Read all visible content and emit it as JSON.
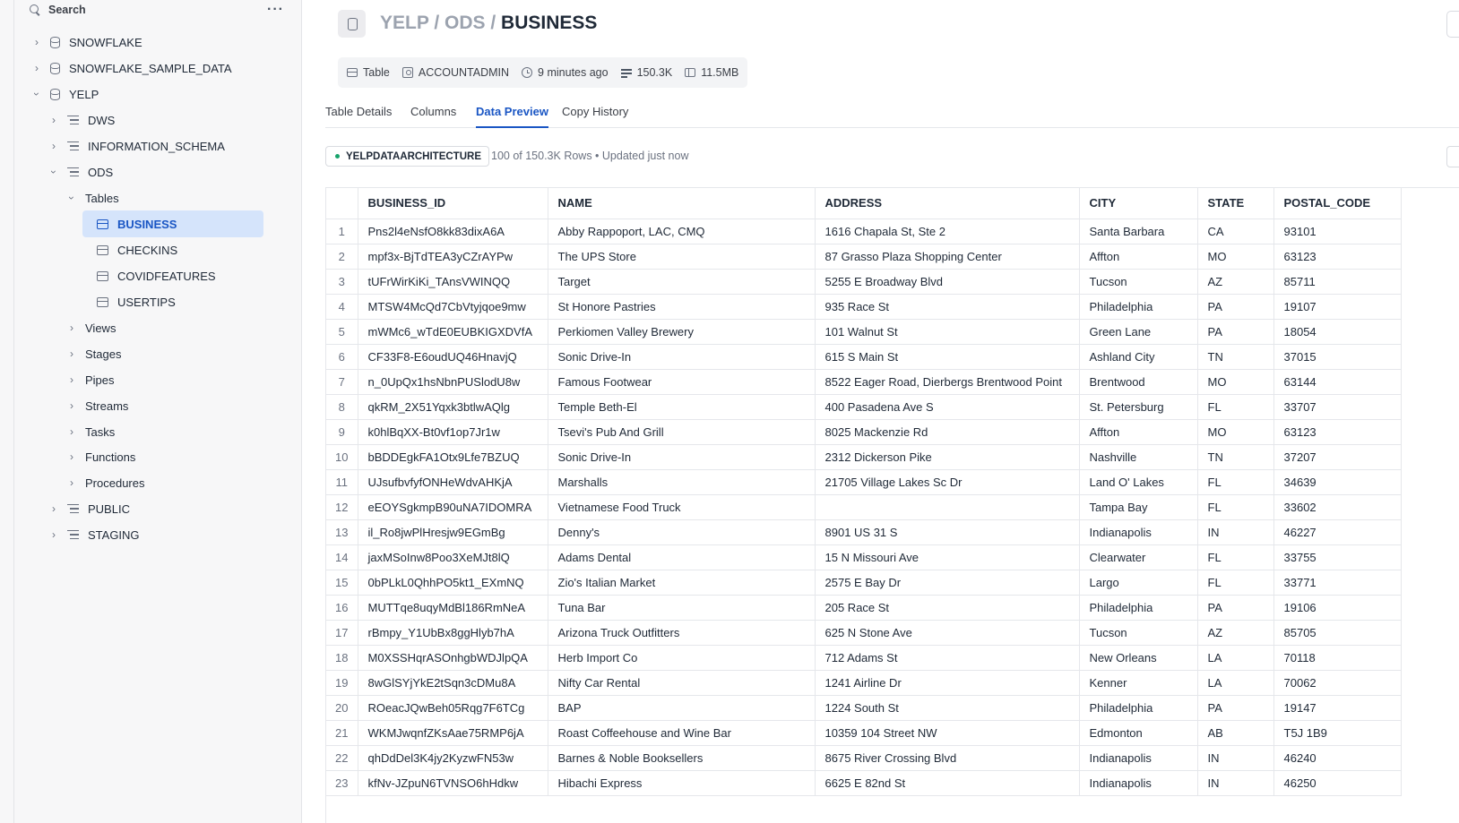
{
  "sidebar": {
    "search_label": "Search",
    "more_label": "···",
    "databases": [
      {
        "label": "SNOWFLAKE"
      },
      {
        "label": "SNOWFLAKE_SAMPLE_DATA"
      },
      {
        "label": "YELP"
      }
    ],
    "schemas": [
      {
        "label": "DWS"
      },
      {
        "label": "INFORMATION_SCHEMA"
      },
      {
        "label": "ODS"
      },
      {
        "label": "PUBLIC"
      },
      {
        "label": "STAGING"
      }
    ],
    "tables_group": "Tables",
    "tables": [
      {
        "label": "BUSINESS"
      },
      {
        "label": "CHECKINS"
      },
      {
        "label": "COVIDFEATURES"
      },
      {
        "label": "USERTIPS"
      }
    ],
    "object_groups": [
      {
        "label": "Views"
      },
      {
        "label": "Stages"
      },
      {
        "label": "Pipes"
      },
      {
        "label": "Streams"
      },
      {
        "label": "Tasks"
      },
      {
        "label": "Functions"
      },
      {
        "label": "Procedures"
      }
    ]
  },
  "header": {
    "crumb_db": "YELP",
    "crumb_schema": "ODS",
    "crumb_table": "BUSINESS",
    "separator": "/"
  },
  "meta": {
    "type": "Table",
    "owner": "ACCOUNTADMIN",
    "updated": "9 minutes ago",
    "row_count": "150.3K",
    "size": "11.5MB"
  },
  "tabs": [
    {
      "label": "Table Details"
    },
    {
      "label": "Columns"
    },
    {
      "label": "Data Preview"
    },
    {
      "label": "Copy History"
    }
  ],
  "preview": {
    "warehouse": "YELPDATAARCHITECTURE",
    "rows_info": "100 of 150.3K Rows • Updated just now"
  },
  "grid": {
    "columns": [
      "BUSINESS_ID",
      "NAME",
      "ADDRESS",
      "CITY",
      "STATE",
      "POSTAL_CODE"
    ],
    "rows": [
      [
        "1",
        "Pns2l4eNsfO8kk83dixA6A",
        "Abby Rappoport, LAC, CMQ",
        "1616 Chapala St, Ste 2",
        "Santa Barbara",
        "CA",
        "93101"
      ],
      [
        "2",
        "mpf3x-BjTdTEA3yCZrAYPw",
        "The UPS Store",
        "87 Grasso Plaza Shopping Center",
        "Affton",
        "MO",
        "63123"
      ],
      [
        "3",
        "tUFrWirKiKi_TAnsVWINQQ",
        "Target",
        "5255 E Broadway Blvd",
        "Tucson",
        "AZ",
        "85711"
      ],
      [
        "4",
        "MTSW4McQd7CbVtyjqoe9mw",
        "St Honore Pastries",
        "935 Race St",
        "Philadelphia",
        "PA",
        "19107"
      ],
      [
        "5",
        "mWMc6_wTdE0EUBKIGXDVfA",
        "Perkiomen Valley Brewery",
        "101 Walnut St",
        "Green Lane",
        "PA",
        "18054"
      ],
      [
        "6",
        "CF33F8-E6oudUQ46HnavjQ",
        "Sonic Drive-In",
        "615 S Main St",
        "Ashland City",
        "TN",
        "37015"
      ],
      [
        "7",
        "n_0UpQx1hsNbnPUSlodU8w",
        "Famous Footwear",
        "8522 Eager Road, Dierbergs Brentwood Point",
        "Brentwood",
        "MO",
        "63144"
      ],
      [
        "8",
        "qkRM_2X51Yqxk3btlwAQlg",
        "Temple Beth-El",
        "400 Pasadena Ave S",
        "St. Petersburg",
        "FL",
        "33707"
      ],
      [
        "9",
        "k0hlBqXX-Bt0vf1op7Jr1w",
        "Tsevi's Pub And Grill",
        "8025 Mackenzie Rd",
        "Affton",
        "MO",
        "63123"
      ],
      [
        "10",
        "bBDDEgkFA1Otx9Lfe7BZUQ",
        "Sonic Drive-In",
        "2312 Dickerson Pike",
        "Nashville",
        "TN",
        "37207"
      ],
      [
        "11",
        "UJsufbvfyfONHeWdvAHKjA",
        "Marshalls",
        "21705 Village Lakes Sc Dr",
        "Land O' Lakes",
        "FL",
        "34639"
      ],
      [
        "12",
        "eEOYSgkmpB90uNA7IDOMRA",
        "Vietnamese Food Truck",
        "",
        "Tampa Bay",
        "FL",
        "33602"
      ],
      [
        "13",
        "il_Ro8jwPlHresjw9EGmBg",
        "Denny's",
        "8901 US 31 S",
        "Indianapolis",
        "IN",
        "46227"
      ],
      [
        "14",
        "jaxMSoInw8Poo3XeMJt8lQ",
        "Adams Dental",
        "15 N Missouri Ave",
        "Clearwater",
        "FL",
        "33755"
      ],
      [
        "15",
        "0bPLkL0QhhPO5kt1_EXmNQ",
        "Zio's Italian Market",
        "2575 E Bay Dr",
        "Largo",
        "FL",
        "33771"
      ],
      [
        "16",
        "MUTTqe8uqyMdBl186RmNeA",
        "Tuna Bar",
        "205 Race St",
        "Philadelphia",
        "PA",
        "19106"
      ],
      [
        "17",
        "rBmpy_Y1UbBx8ggHlyb7hA",
        "Arizona Truck Outfitters",
        "625 N Stone Ave",
        "Tucson",
        "AZ",
        "85705"
      ],
      [
        "18",
        "M0XSSHqrASOnhgbWDJlpQA",
        "Herb Import Co",
        "712 Adams St",
        "New Orleans",
        "LA",
        "70118"
      ],
      [
        "19",
        "8wGlSYjYkE2tSqn3cDMu8A",
        "Nifty Car Rental",
        "1241 Airline Dr",
        "Kenner",
        "LA",
        "70062"
      ],
      [
        "20",
        "ROeacJQwBeh05Rqg7F6TCg",
        "BAP",
        "1224 South St",
        "Philadelphia",
        "PA",
        "19147"
      ],
      [
        "21",
        "WKMJwqnfZKsAae75RMP6jA",
        "Roast Coffeehouse and Wine Bar",
        "10359 104 Street NW",
        "Edmonton",
        "AB",
        "T5J 1B9"
      ],
      [
        "22",
        "qhDdDel3K4jy2KyzwFN53w",
        "Barnes & Noble Booksellers",
        "8675 River Crossing Blvd",
        "Indianapolis",
        "IN",
        "46240"
      ],
      [
        "23",
        "kfNv-JZpuN6TVNSO6hHdkw",
        "Hibachi Express",
        "6625 E 82nd St",
        "Indianapolis",
        "IN",
        "46250"
      ]
    ]
  }
}
